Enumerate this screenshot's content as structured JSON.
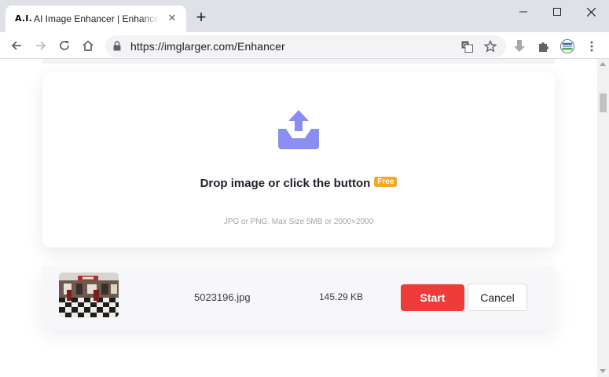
{
  "browser": {
    "tab": {
      "favicon_text": "A.I.",
      "title": "AI Image Enhancer | Enhance photos"
    },
    "address": {
      "url": "https://imglarger.com/Enhancer"
    },
    "icons": {
      "back": "back-arrow-icon",
      "forward": "forward-arrow-icon",
      "reload": "reload-icon",
      "home": "home-icon",
      "lock": "lock-icon",
      "translate": "translate-icon",
      "bookmark": "star-icon",
      "download": "download-icon",
      "extensions": "puzzle-icon",
      "profile": "avatar-icon",
      "menu": "kebab-menu-icon"
    }
  },
  "uploader": {
    "title": "Drop image or click the button",
    "badge": "Free",
    "subtitle": "JPG or PNG. Max Size 5MB or 2000×2000"
  },
  "file": {
    "name": "5023196.jpg",
    "size": "145.29 KB",
    "start_label": "Start",
    "cancel_label": "Cancel"
  },
  "colors": {
    "accent_upload": "#8b8ef0",
    "start_button": "#ef3b3a",
    "free_badge": "#f5a623"
  }
}
